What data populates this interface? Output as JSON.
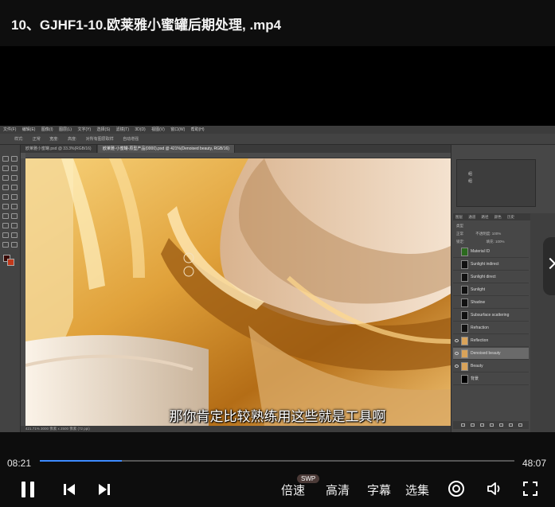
{
  "title": "10、GJHF1-10.欧莱雅小蜜罐后期处理, .mp4",
  "photoshop": {
    "menu": [
      "文件(F)",
      "编辑(E)",
      "图像(I)",
      "图层(L)",
      "文字(Y)",
      "选择(S)",
      "滤镜(T)",
      "3D(D)",
      "视图(V)",
      "窗口(W)",
      "帮助(H)"
    ],
    "options": [
      "样式:",
      "正常",
      "宽度:",
      "高度:",
      "对所有图层取样",
      "自动增强"
    ],
    "tabs": [
      "欧莱雅小蜜罐.psd @ 33.3%(RGB/16)",
      "欧莱雅-小蜜罐-原型产品(0000).psd @ 421%(Denoised beauty, RGB/16)"
    ],
    "status": "421.71%  3000 像素 x 2500 像素 (72 ppi)",
    "panel_rows": [
      "组",
      "组"
    ],
    "layer_tabs": [
      "图层",
      "通道",
      "路径",
      "颜色",
      "历史"
    ],
    "layer_filter": "类型",
    "layer_blend": "正常",
    "layer_opacity": "不透明度: 100%",
    "layer_lock": "锁定:",
    "layer_fill": "填充: 100%",
    "layers": [
      {
        "name": "Material ID",
        "selected": false
      },
      {
        "name": "Sunlight indirect",
        "selected": false
      },
      {
        "name": "Sunlight direct",
        "selected": false
      },
      {
        "name": "Sunlight",
        "selected": false
      },
      {
        "name": "Shadow",
        "selected": false
      },
      {
        "name": "Subsurface scattering",
        "selected": false
      },
      {
        "name": "Refraction",
        "selected": false
      },
      {
        "name": "Reflection",
        "selected": false
      },
      {
        "name": "Denoised beauty",
        "selected": true
      },
      {
        "name": "Beauty",
        "selected": false
      },
      {
        "name": "背景",
        "selected": false
      }
    ]
  },
  "subtitle": "那你肯定比较熟练用这些就是工具啊",
  "player": {
    "current_time": "08:21",
    "duration": "48:07",
    "progress_fraction": 0.1736,
    "speed_label": "倍速",
    "speed_badge": "SWP",
    "quality_label": "高清",
    "subtitle_label": "字幕",
    "episodes_label": "选集",
    "accent_color": "#3d8bff"
  }
}
